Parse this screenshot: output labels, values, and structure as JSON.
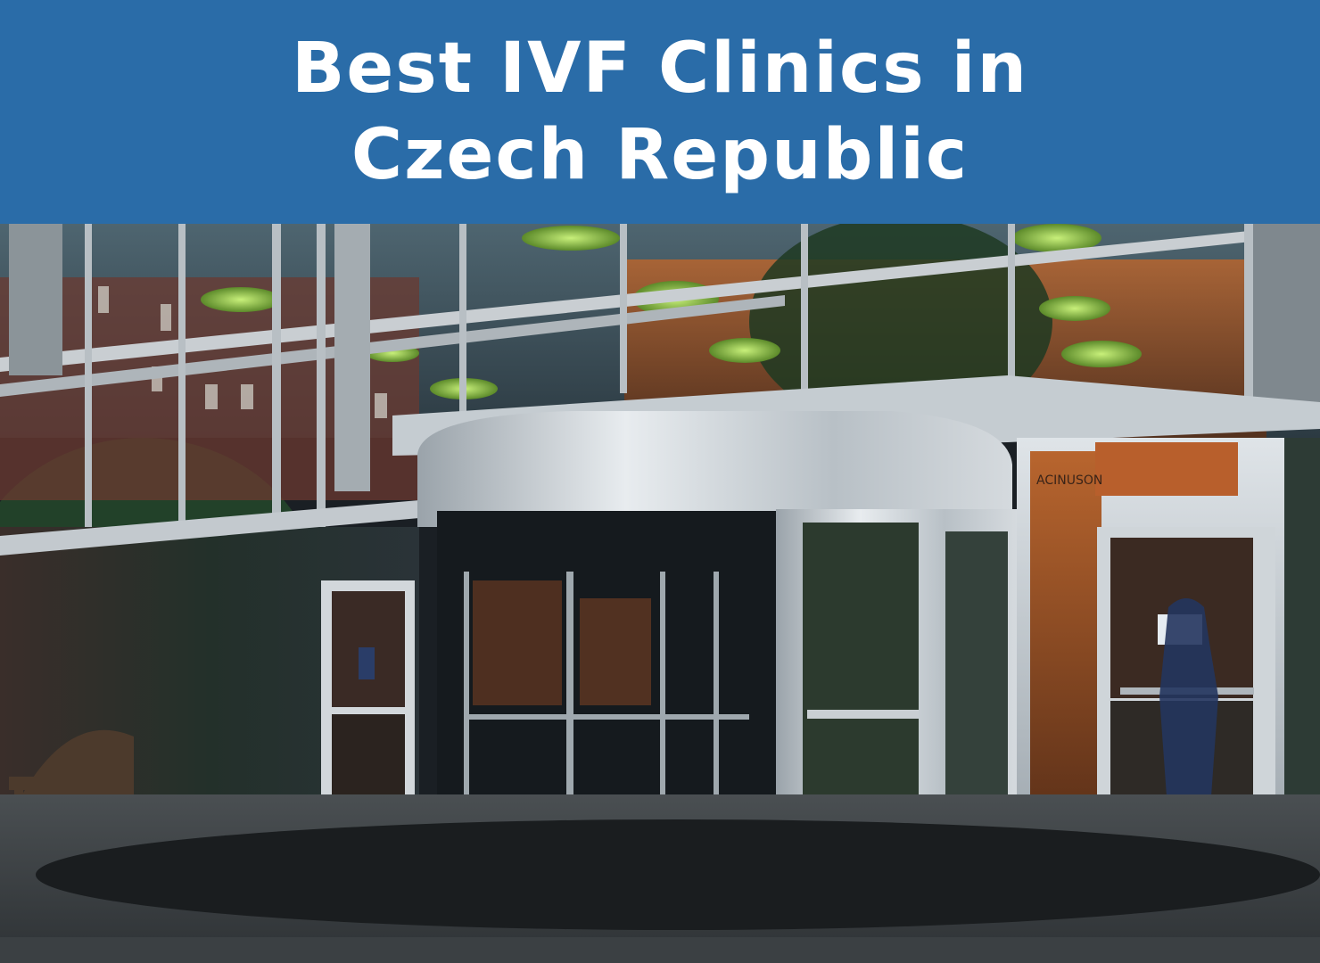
{
  "banner": {
    "title_line1": "Best IVF Clinics in",
    "title_line2": "Czech Republic",
    "background_color": "#2a6ca8",
    "text_color": "#ffffff"
  },
  "photo": {
    "sign_text": "ACINUSON"
  }
}
